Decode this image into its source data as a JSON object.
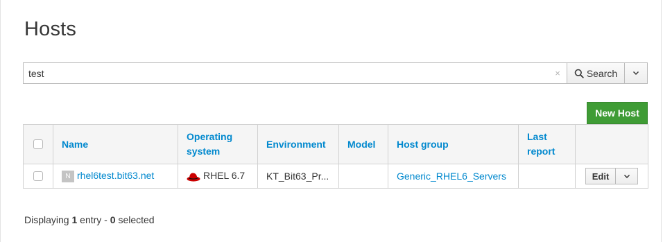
{
  "page": {
    "title": "Hosts"
  },
  "search": {
    "value": "test",
    "clear_glyph": "×",
    "button_label": "Search",
    "search_icon": "search-icon",
    "dropdown_icon": "chevron-down-icon"
  },
  "actions": {
    "new_host_label": "New Host",
    "new_host_color": "#3f9c35"
  },
  "table": {
    "columns": [
      {
        "key": "name",
        "label": "Name"
      },
      {
        "key": "os",
        "label": "Operating system"
      },
      {
        "key": "environment",
        "label": "Environment"
      },
      {
        "key": "model",
        "label": "Model"
      },
      {
        "key": "hostgroup",
        "label": "Host group"
      },
      {
        "key": "last_report",
        "label": "Last report"
      }
    ],
    "rows": [
      {
        "badge": "N",
        "name": "rhel6test.bit63.net",
        "os": "RHEL 6.7",
        "environment": "KT_Bit63_Pr...",
        "model": "",
        "hostgroup": "Generic_RHEL6_Servers",
        "last_report": "",
        "edit_label": "Edit"
      }
    ]
  },
  "footer": {
    "prefix": "Displaying",
    "count": "1",
    "middle": "entry -",
    "selected": "0",
    "suffix": "selected"
  },
  "colors": {
    "link": "#0088ce",
    "text": "#363636",
    "os_logo": "#cc0000"
  }
}
